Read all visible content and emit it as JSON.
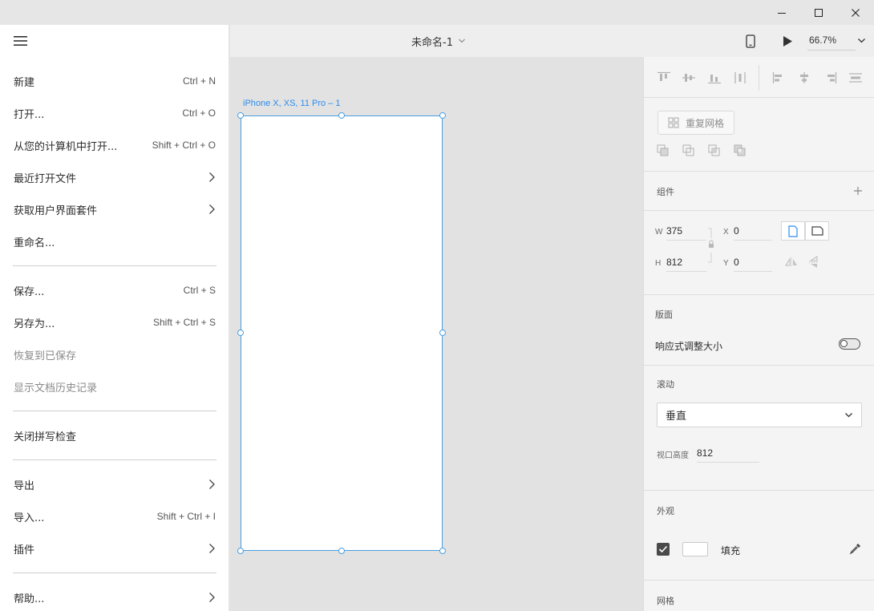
{
  "window": {
    "minimize_icon": "minimize-icon",
    "maximize_icon": "maximize-icon",
    "close_icon": "close-icon"
  },
  "menu": {
    "items": [
      {
        "label": "新建",
        "shortcut": "Ctrl + N"
      },
      {
        "label": "打开...",
        "shortcut": "Ctrl + O"
      },
      {
        "label": "从您的计算机中打开...",
        "shortcut": "Shift + Ctrl + O"
      },
      {
        "label": "最近打开文件",
        "submenu": true
      },
      {
        "label": "获取用户界面套件",
        "submenu": true
      },
      {
        "label": "重命名..."
      },
      {
        "label": "保存...",
        "shortcut": "Ctrl + S"
      },
      {
        "label": "另存为...",
        "shortcut": "Shift + Ctrl + S"
      },
      {
        "label": "恢复到已保存",
        "disabled": true
      },
      {
        "label": "显示文档历史记录",
        "disabled": true
      },
      {
        "label": "关闭拼写检查"
      },
      {
        "label": "导出",
        "submenu": true
      },
      {
        "label": "导入...",
        "shortcut": "Shift + Ctrl + I"
      },
      {
        "label": "插件",
        "submenu": true
      },
      {
        "label": "帮助...",
        "submenu": true
      }
    ]
  },
  "toolbar": {
    "doc_title": "未命名-1",
    "zoom": "66.7%"
  },
  "canvas": {
    "artboard_label": "iPhone X, XS, 11 Pro – 1"
  },
  "panel": {
    "repeat_grid_label": "重复网格",
    "components_label": "组件",
    "w_label": "W",
    "w_value": "375",
    "h_label": "H",
    "h_value": "812",
    "x_label": "X",
    "x_value": "0",
    "y_label": "Y",
    "y_value": "0",
    "layout_label": "版面",
    "responsive_label": "响应式调整大小",
    "responsive_on": false,
    "scroll_label": "滚动",
    "scroll_value": "垂直",
    "viewport_label": "视口高度",
    "viewport_value": "812",
    "appearance_label": "外观",
    "fill_label": "填充",
    "fill_checked": true,
    "fill_color": "#FFFFFF",
    "grid_label": "网格"
  },
  "colors": {
    "accent": "#4b9fe0",
    "label_blue": "#2d8ceb"
  }
}
